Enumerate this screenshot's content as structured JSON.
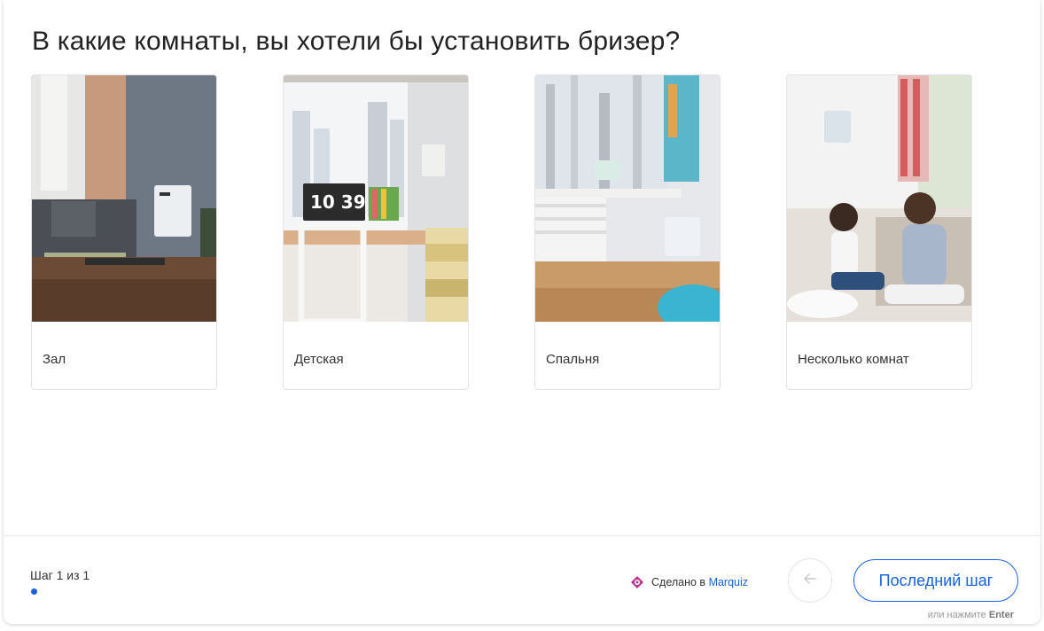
{
  "question": {
    "title": "В какие комнаты, вы хотели бы установить бризер?"
  },
  "options": [
    {
      "label": "Зал",
      "image": "living-room-photo"
    },
    {
      "label": "Детская",
      "image": "kids-room-photo"
    },
    {
      "label": "Спальня",
      "image": "bedroom-photo"
    },
    {
      "label": "Несколько комнат",
      "image": "mother-and-daughter-photo"
    }
  ],
  "footer": {
    "step_text": "Шаг 1 из 1",
    "made_with": "Сделано в",
    "brand": "Marquiz",
    "back_icon": "arrow-left-icon",
    "next_label": "Последний шаг",
    "hint_prefix": "или нажмите",
    "hint_key": "Enter"
  },
  "colors": {
    "accent": "#1862e0",
    "brand_logo": "#b8348f"
  }
}
